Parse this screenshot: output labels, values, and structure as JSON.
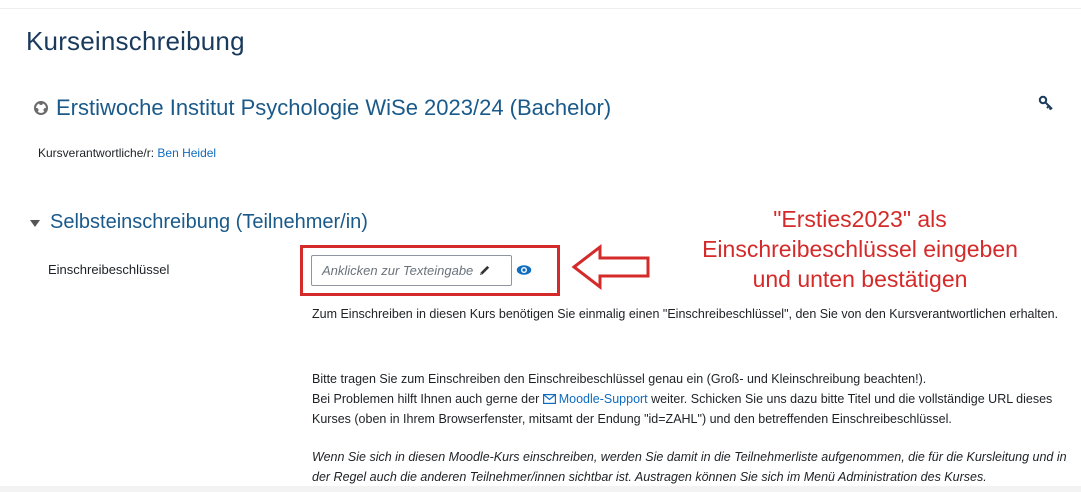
{
  "page": {
    "title": "Kurseinschreibung"
  },
  "course": {
    "icon": "course-icon",
    "title": "Erstiwoche Institut Psychologie WiSe 2023/24 (Bachelor)",
    "teacher_label": "Kursverantwortliche/r:",
    "teacher_name": "Ben Heidel",
    "key_icon": "key-icon"
  },
  "section": {
    "title": "Selbsteinschreibung (Teilnehmer/in)",
    "field_label": "Einschreibeschlüssel",
    "input_placeholder": "Anklicken zur Texteingabe",
    "pencil_icon": "pencil-icon",
    "eye_icon": "eye-icon"
  },
  "annotation": {
    "line1": "\"Ersties2023\" als",
    "line2": "Einschreibeschlüssel eingeben",
    "line3": "und unten bestätigen",
    "color": "#d42a2a"
  },
  "description": {
    "p1": "Zum Einschreiben in diesen Kurs benötigen Sie einmalig einen \"Einschreibeschlüssel\", den Sie von den Kursverantwortlichen erhalten.",
    "p2_line1": "Bitte tragen Sie zum Einschreiben den Einschreibeschlüssel genau ein (Groß- und Kleinschreibung beachten!).",
    "p2_line2_before": "Bei Problemen hilft Ihnen auch gerne der",
    "p2_link": "Moodle-Support",
    "p2_line2_after": "weiter. Schicken Sie uns dazu bitte Titel und die vollständige URL dieses Kurses (oben in Ihrem Browserfenster, mitsamt der Endung \"id=ZAHL\") und den betreffenden Einschreibeschlüssel.",
    "p3": "Wenn Sie sich in diesen Moodle-Kurs einschreiben, werden Sie damit in die Teilnehmerliste aufgenommen, die für die Kursleitung und in der Regel auch die anderen Teilnehmer/innen sichtbar ist. Austragen können Sie sich im Menü Administration des Kurses."
  }
}
